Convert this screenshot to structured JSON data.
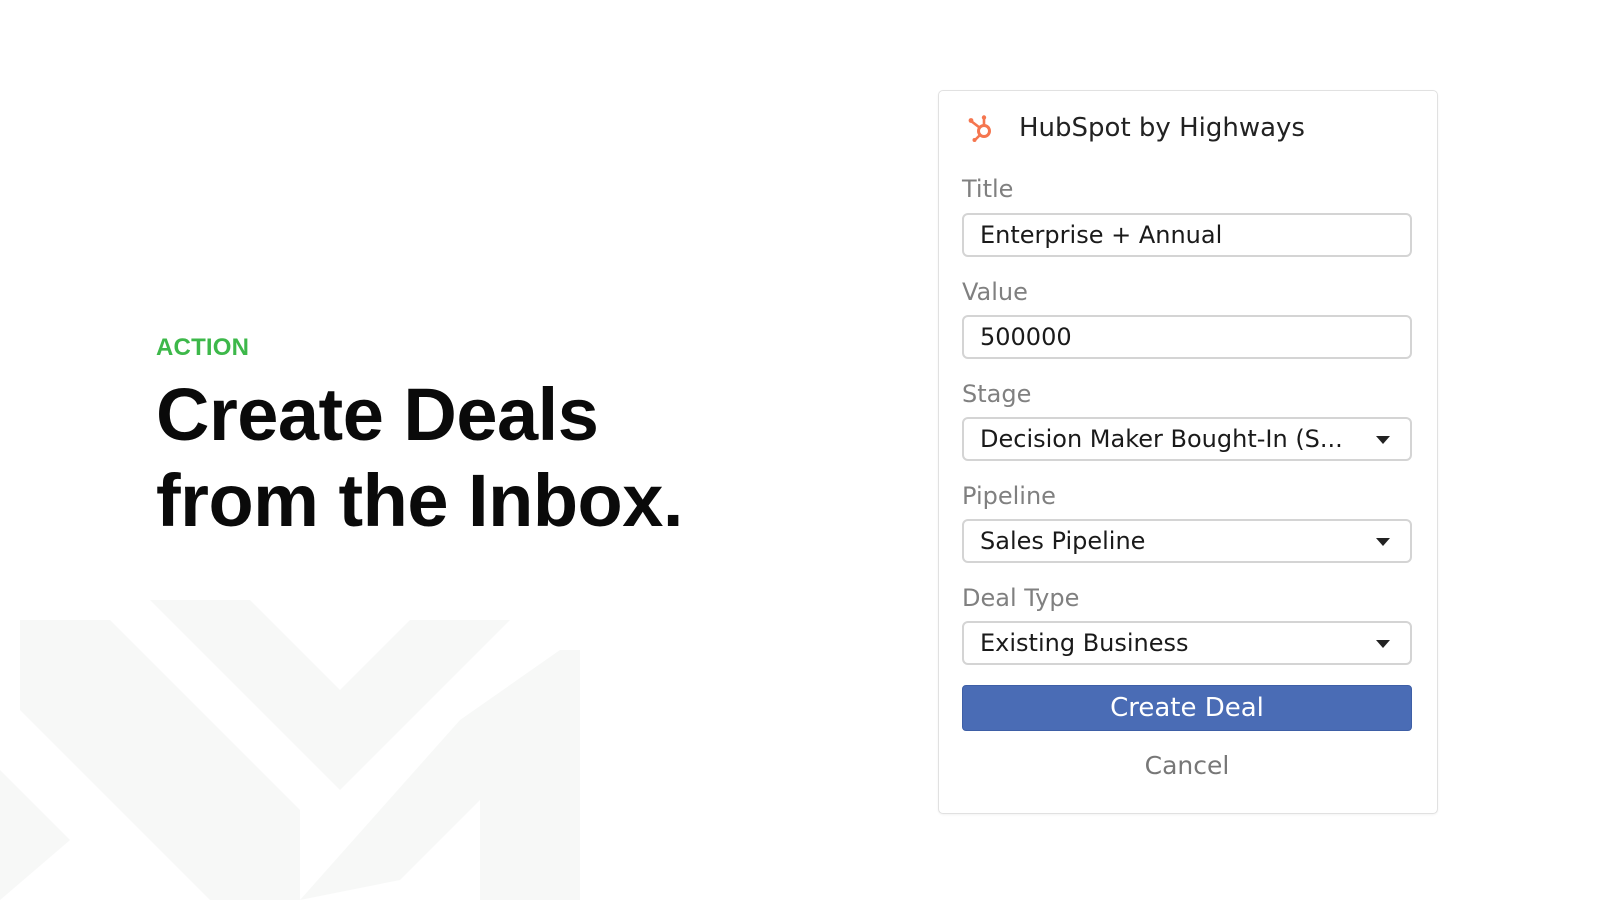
{
  "hero": {
    "eyebrow": "ACTION",
    "headline_line1": "Create Deals",
    "headline_line2": "from the Inbox."
  },
  "panel": {
    "title": "HubSpot by Highways",
    "logo_icon": "hubspot-sprocket-icon",
    "fields": [
      {
        "label": "Title",
        "value": "Enterprise + Annual",
        "type": "text"
      },
      {
        "label": "Value",
        "value": "500000",
        "type": "text"
      },
      {
        "label": "Stage",
        "value": "Decision Maker Bought-In (S...",
        "type": "select"
      },
      {
        "label": "Pipeline",
        "value": "Sales Pipeline",
        "type": "select"
      },
      {
        "label": "Deal Type",
        "value": "Existing Business",
        "type": "select"
      }
    ],
    "create_label": "Create Deal",
    "cancel_label": "Cancel"
  },
  "colors": {
    "accent_green": "#3db84a",
    "primary_button": "#4a6cb5",
    "hubspot_orange": "#f5764f"
  }
}
